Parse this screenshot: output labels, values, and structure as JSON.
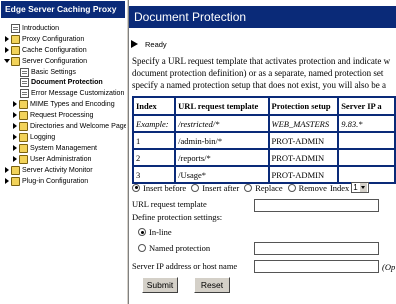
{
  "nav": {
    "title": "Edge Server Caching Proxy",
    "items": [
      {
        "label": "Introduction",
        "icon": "page-icon"
      },
      {
        "label": "Proxy Configuration",
        "icon": "folder-icon",
        "toggle": "collapsed"
      },
      {
        "label": "Cache Configuration",
        "icon": "folder-icon",
        "toggle": "collapsed"
      },
      {
        "label": "Server Configuration",
        "icon": "folder-icon",
        "toggle": "expanded"
      },
      {
        "label": "Basic Settings",
        "icon": "page-icon"
      },
      {
        "label": "Document Protection",
        "icon": "page-icon",
        "selected": true
      },
      {
        "label": "Error Message Customization",
        "icon": "page-icon"
      },
      {
        "label": "MIME Types and Encoding",
        "icon": "folder-icon",
        "toggle": "collapsed"
      },
      {
        "label": "Request Processing",
        "icon": "folder-icon",
        "toggle": "collapsed"
      },
      {
        "label": "Directories and Welcome Page",
        "icon": "folder-icon",
        "toggle": "collapsed"
      },
      {
        "label": "Logging",
        "icon": "folder-icon",
        "toggle": "collapsed"
      },
      {
        "label": "System Management",
        "icon": "folder-icon",
        "toggle": "collapsed"
      },
      {
        "label": "User Administration",
        "icon": "folder-icon",
        "toggle": "collapsed"
      },
      {
        "label": "Server Activity Monitor",
        "icon": "folder-icon",
        "toggle": "collapsed"
      },
      {
        "label": "Plug-in Configuration",
        "icon": "folder-icon",
        "toggle": "collapsed"
      }
    ]
  },
  "main": {
    "title": "Document Protection",
    "status": "Ready",
    "description": [
      "Specify a URL request template that activates protection and indicate w",
      "document protection definition) or as a separate, named protection set",
      "specify a named protection setup that does not exist, you will also be a"
    ]
  },
  "table": {
    "headers": [
      "Index",
      "URL request template",
      "Protection setup",
      "Server IP a"
    ],
    "rows": [
      [
        "Example:",
        "/restricted/*",
        "WEB_MASTERS",
        "9.83.*"
      ],
      [
        "1",
        "/admin-bin/*",
        "PROT-ADMIN",
        ""
      ],
      [
        "2",
        "/reports/*",
        "PROT-ADMIN",
        ""
      ],
      [
        "3",
        "/Usage*",
        "PROT-ADMIN",
        ""
      ]
    ]
  },
  "form": {
    "position_options": [
      "Insert before",
      "Insert after",
      "Replace",
      "Remove"
    ],
    "selected_position": "Insert before",
    "index_label": "Index",
    "index_value": "1",
    "url_template_label": "URL request template",
    "define_label": "Define protection settings:",
    "inline_label": "In-line",
    "named_label": "Named protection",
    "ip_label": "Server IP address or host name",
    "ip_hint": "(Op",
    "submit_label": "Submit",
    "reset_label": "Reset"
  },
  "colors": {
    "header_blue": "#0a2a78",
    "panel_gray": "#d4d0c8"
  }
}
